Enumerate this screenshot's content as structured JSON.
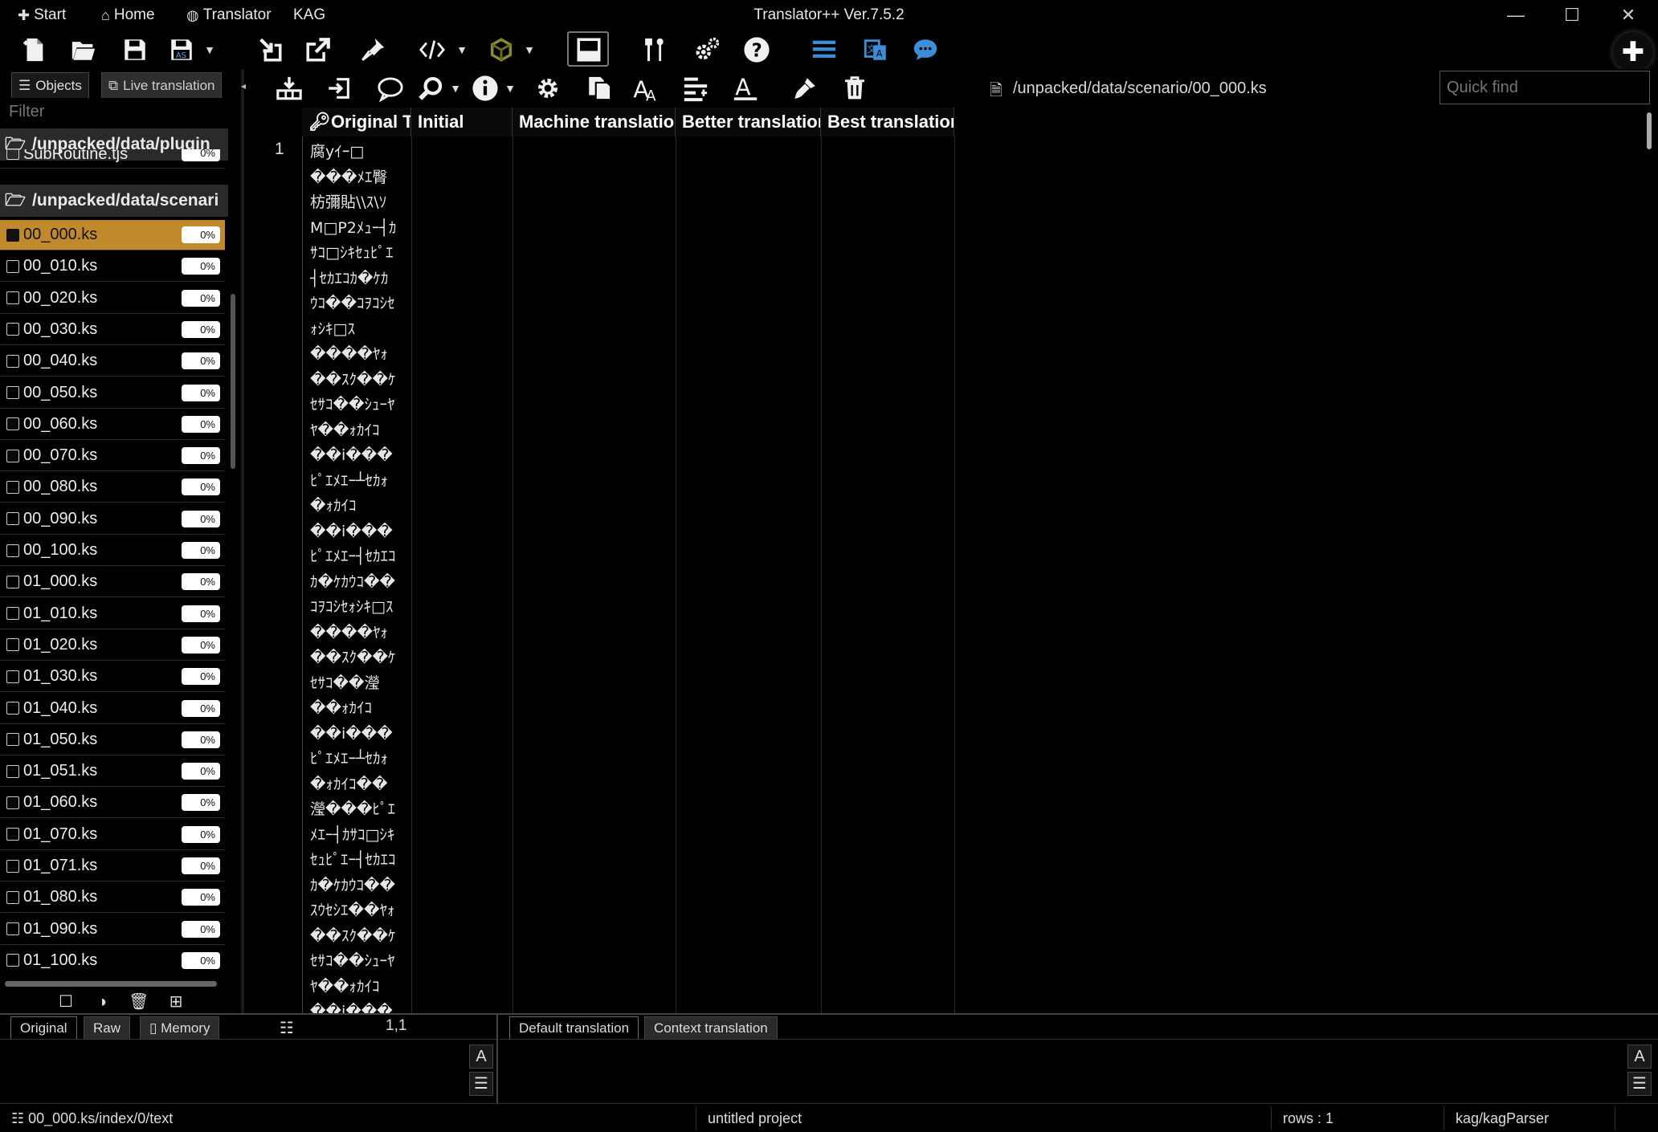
{
  "menu": {
    "start": "Start",
    "home": "Home",
    "translator": "Translator",
    "kag": "KAG"
  },
  "app_title": "Translator++ Ver.7.5.2",
  "left_tabs": {
    "objects": "Objects",
    "live_translation": "Live translation"
  },
  "filter": {
    "placeholder": "Filter"
  },
  "tree": {
    "folder1": "/unpacked/data/plugin_",
    "partial_file": "SubRoutine.tjs",
    "partial_pct": "0%",
    "folder2": "/unpacked/data/scenari",
    "files": [
      {
        "name": "00_000.ks",
        "pct": "0%"
      },
      {
        "name": "00_010.ks",
        "pct": "0%"
      },
      {
        "name": "00_020.ks",
        "pct": "0%"
      },
      {
        "name": "00_030.ks",
        "pct": "0%"
      },
      {
        "name": "00_040.ks",
        "pct": "0%"
      },
      {
        "name": "00_050.ks",
        "pct": "0%"
      },
      {
        "name": "00_060.ks",
        "pct": "0%"
      },
      {
        "name": "00_070.ks",
        "pct": "0%"
      },
      {
        "name": "00_080.ks",
        "pct": "0%"
      },
      {
        "name": "00_090.ks",
        "pct": "0%"
      },
      {
        "name": "00_100.ks",
        "pct": "0%"
      },
      {
        "name": "01_000.ks",
        "pct": "0%"
      },
      {
        "name": "01_010.ks",
        "pct": "0%"
      },
      {
        "name": "01_020.ks",
        "pct": "0%"
      },
      {
        "name": "01_030.ks",
        "pct": "0%"
      },
      {
        "name": "01_040.ks",
        "pct": "0%"
      },
      {
        "name": "01_050.ks",
        "pct": "0%"
      },
      {
        "name": "01_051.ks",
        "pct": "0%"
      },
      {
        "name": "01_060.ks",
        "pct": "0%"
      },
      {
        "name": "01_070.ks",
        "pct": "0%"
      },
      {
        "name": "01_071.ks",
        "pct": "0%"
      },
      {
        "name": "01_080.ks",
        "pct": "0%"
      },
      {
        "name": "01_090.ks",
        "pct": "0%"
      },
      {
        "name": "01_100.ks",
        "pct": "0%"
      }
    ]
  },
  "path": "/unpacked/data/scenario/00_000.ks",
  "quick_find": {
    "placeholder": "Quick find"
  },
  "grid": {
    "headers": {
      "original": "Original Tex",
      "initial": "Initial",
      "machine": "Machine translation",
      "better": "Better translation",
      "best": "Best translation"
    },
    "row_number": "1",
    "original_text": "腐yｲｰ□\n���ﾒｴ臀\n枋彌貼\\\\ｽ\\ｿ\nM□P2ﾒｭｰ┤ｶ\nｻｺ□ｼｷｾｭﾋﾟｴ\n┤ｾｶｴｺｶ�ｹｶ\nｳｺ��ｺｦｺｼｾ\nｫｼｷ□ｽ\n����ﾔｫ\n��ｽｸ��ｹ\nｾｻｺ��ｼｭｰﾔ\nﾔ��ｫｶｲｺ\n��i���\nﾋﾟｴﾒｴｰ┴ｾｶｫ\n�ｫｶｲｺ\n��i���\nﾋﾟｴﾒｴｰ┤ｾｶｴｺ\nｶ�ｹｶｳｺ��\nｺｦｺｼｾｫｼｷ□ｽ\n����ﾔｫ\n��ｽｸ��ｹ\nｾｻｺ��瀅\n��ｫｶｲｺ\n��i���\nﾋﾟｴﾒｴｰ┴ｾｶｫ\n�ｫｶｲｺ��\n瀅���ﾋﾟｴ\nﾒｴｰ┤ｶｻｺ□ｼｷ\nｾｭﾋﾟｴｰ┤ｾｶｴｺ\nｶ�ｹｶｳｺ��\nｽｳｾｼｴ��ﾔｫ\n��ｽｸ��ｹ\nｾｻｺ��ｼｭｰﾔ\nﾔ��ｫｶｲｺ\n��i���"
  },
  "bottom_left": {
    "tab_original": "Original",
    "tab_raw": "Raw",
    "tab_memory": "Memory",
    "coord": "1,1"
  },
  "bottom_right": {
    "tab_default": "Default translation",
    "tab_context": "Context translation"
  },
  "status": {
    "path": "00_000.ks/index/0/text",
    "project": "untitled project",
    "rows": "rows : 1",
    "parser": "kag/kagParser"
  }
}
